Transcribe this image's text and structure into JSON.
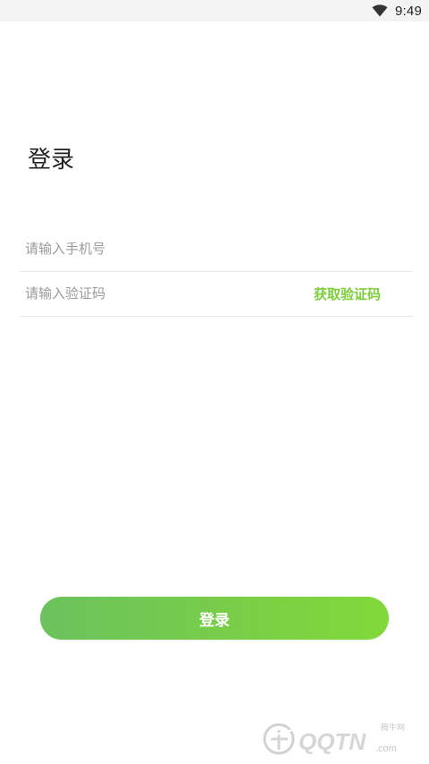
{
  "status_bar": {
    "time": "9:49",
    "icons": [
      "wifi-icon"
    ]
  },
  "page": {
    "title": "登录"
  },
  "form": {
    "phone_placeholder": "请输入手机号",
    "phone_value": "",
    "code_placeholder": "请输入验证码",
    "code_value": "",
    "get_code_label": "获取验证码",
    "submit_label": "登录"
  },
  "colors": {
    "accent": "#7bcf3a",
    "button_gradient_start": "#6cc25d",
    "button_gradient_end": "#82d93a",
    "background": "#ffffff",
    "status_bar_bg": "#f3f3f3"
  },
  "watermark": {
    "logo_text": "QQTN.com",
    "site_cn": "腾牛网"
  }
}
